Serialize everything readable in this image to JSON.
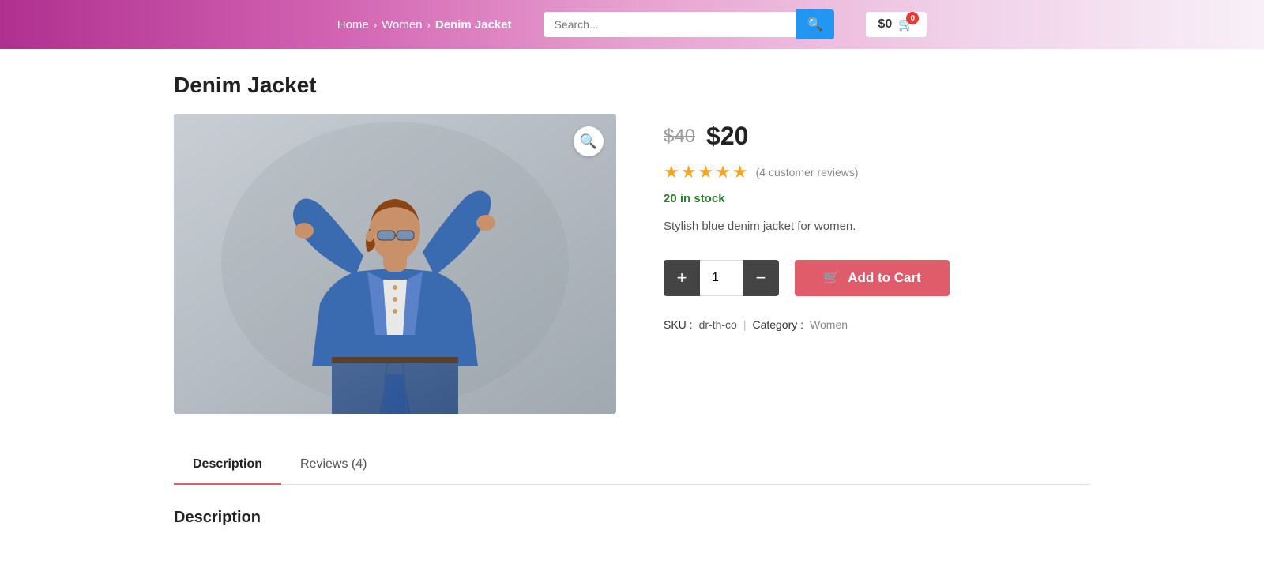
{
  "header": {
    "breadcrumb": {
      "home": "Home",
      "women": "Women",
      "current": "Denim Jacket"
    },
    "search": {
      "placeholder": "Search..."
    },
    "cart": {
      "price": "$0",
      "item_count": "0"
    }
  },
  "product": {
    "title": "Denim Jacket",
    "price_old": "$40",
    "price_new": "$20",
    "stars": "★★★★★",
    "review_count": "(4 customer reviews)",
    "stock": "20 in stock",
    "description": "Stylish blue denim jacket for women.",
    "quantity": "1",
    "add_to_cart": "Add to Cart",
    "sku_label": "SKU :",
    "sku_value": "dr-th-co",
    "category_label": "Category :",
    "category_value": "Women",
    "separator": "|"
  },
  "tabs": [
    {
      "label": "Description",
      "active": true
    },
    {
      "label": "Reviews (4)",
      "active": false
    }
  ],
  "tab_content_title": "Description",
  "icons": {
    "search": "🔍",
    "cart": "🛒",
    "zoom": "🔍",
    "plus": "+",
    "minus": "−",
    "cart_btn": "🛒"
  }
}
